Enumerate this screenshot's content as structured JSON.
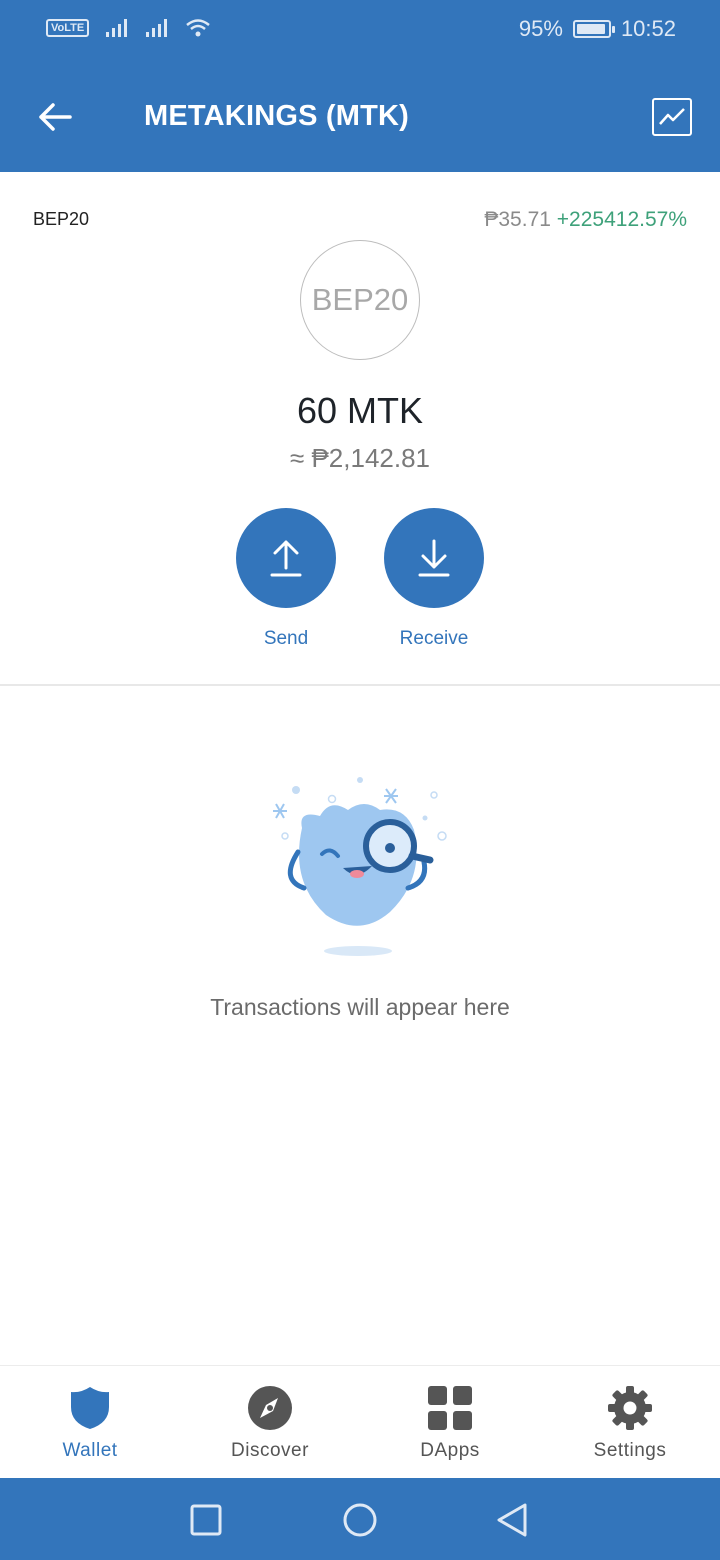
{
  "status_bar": {
    "volte": "VoLTE",
    "battery_percent": "95%",
    "battery_level": 0.95,
    "time": "10:52"
  },
  "header": {
    "title": "METAKINGS (MTK)"
  },
  "token": {
    "network": "BEP20",
    "logo_text": "BEP20",
    "price": "₱35.71",
    "change": "+225412.57%",
    "balance": "60 MTK",
    "fiat_balance": "≈ ₱2,142.81"
  },
  "actions": {
    "send_label": "Send",
    "receive_label": "Receive"
  },
  "empty_state": {
    "message": "Transactions will appear here"
  },
  "bottom_nav": {
    "items": [
      {
        "label": "Wallet",
        "icon": "shield-icon",
        "active": true
      },
      {
        "label": "Discover",
        "icon": "compass-icon",
        "active": false
      },
      {
        "label": "DApps",
        "icon": "grid-icon",
        "active": false
      },
      {
        "label": "Settings",
        "icon": "gear-icon",
        "active": false
      }
    ]
  },
  "colors": {
    "primary": "#3375bb",
    "positive": "#3ea17a",
    "illustration": "#9ec7f0"
  }
}
